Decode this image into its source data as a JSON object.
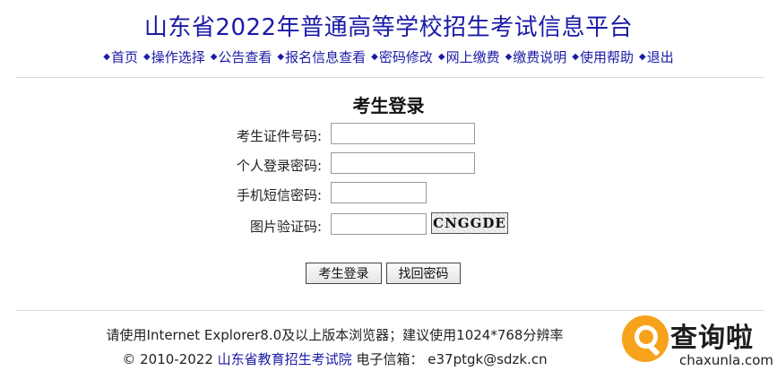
{
  "header": {
    "site_title": "山东省2022年普通高等学校招生考试信息平台"
  },
  "nav": {
    "items": [
      {
        "label": "首页"
      },
      {
        "label": "操作选择"
      },
      {
        "label": "公告查看"
      },
      {
        "label": "报名信息查看"
      },
      {
        "label": "密码修改"
      },
      {
        "label": "网上缴费"
      },
      {
        "label": "缴费说明"
      },
      {
        "label": "使用帮助"
      },
      {
        "label": "退出"
      }
    ],
    "bullet_glyph": "◆"
  },
  "login": {
    "title": "考生登录",
    "fields": [
      {
        "label": "考生证件号码:",
        "value": ""
      },
      {
        "label": "个人登录密码:",
        "value": ""
      },
      {
        "label": "手机短信密码:",
        "value": ""
      },
      {
        "label": "图片验证码:",
        "value": ""
      }
    ],
    "captcha_text": "CNGGDE",
    "login_button": "考生登录",
    "find_password_button": "找回密码"
  },
  "footer": {
    "browser_note": "请使用Internet Explorer8.0及以上版本浏览器；建议使用1024*768分辨率",
    "copyright": "© 2010-2022",
    "org_link": "山东省教育招生考试院",
    "email_label": "电子信箱：",
    "email": "e37ptgk@sdzk.cn"
  },
  "watermark": {
    "cn": "查询啦",
    "en": "chaxunla.com"
  },
  "colors": {
    "title_blue": "#1a1aa6",
    "watermark_orange": "#f6a21a"
  }
}
